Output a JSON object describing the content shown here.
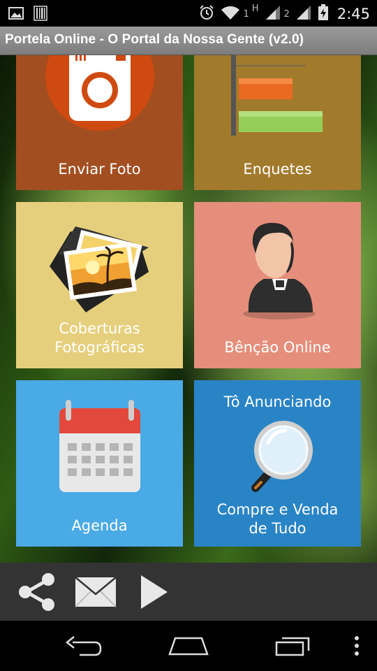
{
  "status_bar": {
    "time": "2:45",
    "network_1": "1",
    "network_h": "H",
    "network_2": "2",
    "icons": [
      "image-icon",
      "barcode-icon",
      "alarm-icon",
      "wifi-icon",
      "signal-icon",
      "battery-charging-icon"
    ]
  },
  "app": {
    "title": "Portela Online - O Portal da Nossa Gente (v2.0)"
  },
  "tiles": [
    {
      "label": "Enviar Foto",
      "icon": "camera-icon",
      "color": "#a34e20"
    },
    {
      "label": "Enquetes",
      "icon": "bar-chart-icon",
      "color": "#a27a2c"
    },
    {
      "label_line1": "Coberturas",
      "label_line2": "Fotográficas",
      "icon": "photos-folder-icon",
      "color": "#e6cf7c"
    },
    {
      "label": "Bênção Online",
      "icon": "priest-icon",
      "color": "#e58e7b"
    },
    {
      "label": "Agenda",
      "icon": "calendar-icon",
      "color": "#4aaae6"
    },
    {
      "top_label": "Tô Anunciando",
      "label_line1": "Compre e Venda",
      "label_line2": "de Tudo",
      "icon": "magnifier-icon",
      "color": "#2984c6"
    }
  ],
  "toolbar": {
    "icons": [
      "share-icon",
      "mail-icon",
      "play-icon"
    ]
  },
  "nav": {
    "icons": [
      "back-icon",
      "home-icon",
      "recents-icon",
      "menu-icon"
    ]
  }
}
